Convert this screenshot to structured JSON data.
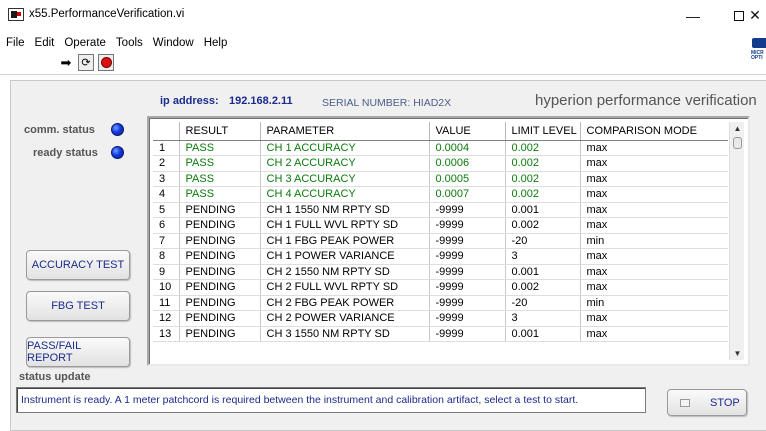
{
  "window": {
    "title": "x55.PerformanceVerification.vi",
    "minimize": "—",
    "close": "✕"
  },
  "menu": [
    "File",
    "Edit",
    "Operate",
    "Tools",
    "Window",
    "Help"
  ],
  "toolbar": {
    "run_icon": "➡",
    "run_continuous_icon": "⟳",
    "abort_icon": "stop-circle"
  },
  "header": {
    "ip_label": "ip address:",
    "ip_value": "192.168.2.11",
    "serial": "SERIAL NUMBER: HIAD2X",
    "app_title": "hyperion performance verification"
  },
  "status": {
    "comm_label": "comm. status",
    "ready_label": "ready status",
    "led_color": "#1338e0"
  },
  "buttons": {
    "accuracy": "ACCURACY TEST",
    "fbg": "FBG TEST",
    "report": "PASS/FAIL REPORT",
    "stop": "STOP"
  },
  "table": {
    "headers": [
      "",
      "RESULT",
      "PARAMETER",
      "VALUE",
      "LIMIT LEVEL",
      "COMPARISON MODE"
    ],
    "rows": [
      [
        "1",
        "PASS",
        "CH 1 ACCURACY",
        "0.0004",
        "0.002",
        "max"
      ],
      [
        "2",
        "PASS",
        "CH 2 ACCURACY",
        "0.0006",
        "0.002",
        "max"
      ],
      [
        "3",
        "PASS",
        "CH 3 ACCURACY",
        "0.0005",
        "0.002",
        "max"
      ],
      [
        "4",
        "PASS",
        "CH 4 ACCURACY",
        "0.0007",
        "0.002",
        "max"
      ],
      [
        "5",
        "PENDING",
        "CH 1 1550 NM RPTY SD",
        "-9999",
        "0.001",
        "max"
      ],
      [
        "6",
        "PENDING",
        "CH 1 FULL WVL RPTY SD",
        "-9999",
        "0.002",
        "max"
      ],
      [
        "7",
        "PENDING",
        "CH 1 FBG PEAK POWER",
        "-9999",
        "-20",
        "min"
      ],
      [
        "8",
        "PENDING",
        "CH 1 POWER VARIANCE",
        "-9999",
        "3",
        "max"
      ],
      [
        "9",
        "PENDING",
        "CH 2 1550 NM RPTY SD",
        "-9999",
        "0.001",
        "max"
      ],
      [
        "10",
        "PENDING",
        "CH 2 FULL WVL RPTY SD",
        "-9999",
        "0.002",
        "max"
      ],
      [
        "11",
        "PENDING",
        "CH 2 FBG PEAK POWER",
        "-9999",
        "-20",
        "min"
      ],
      [
        "12",
        "PENDING",
        "CH 2 POWER VARIANCE",
        "-9999",
        "3",
        "max"
      ],
      [
        "13",
        "PENDING",
        "CH 3 1550 NM RPTY SD",
        "-9999",
        "0.001",
        "max"
      ]
    ],
    "pass_color": "#0a7a0a"
  },
  "status_update": {
    "label": "status update",
    "message": "Instrument is ready.  A 1 meter patchcord is required between the instrument and calibration artifact, select a test to start."
  }
}
